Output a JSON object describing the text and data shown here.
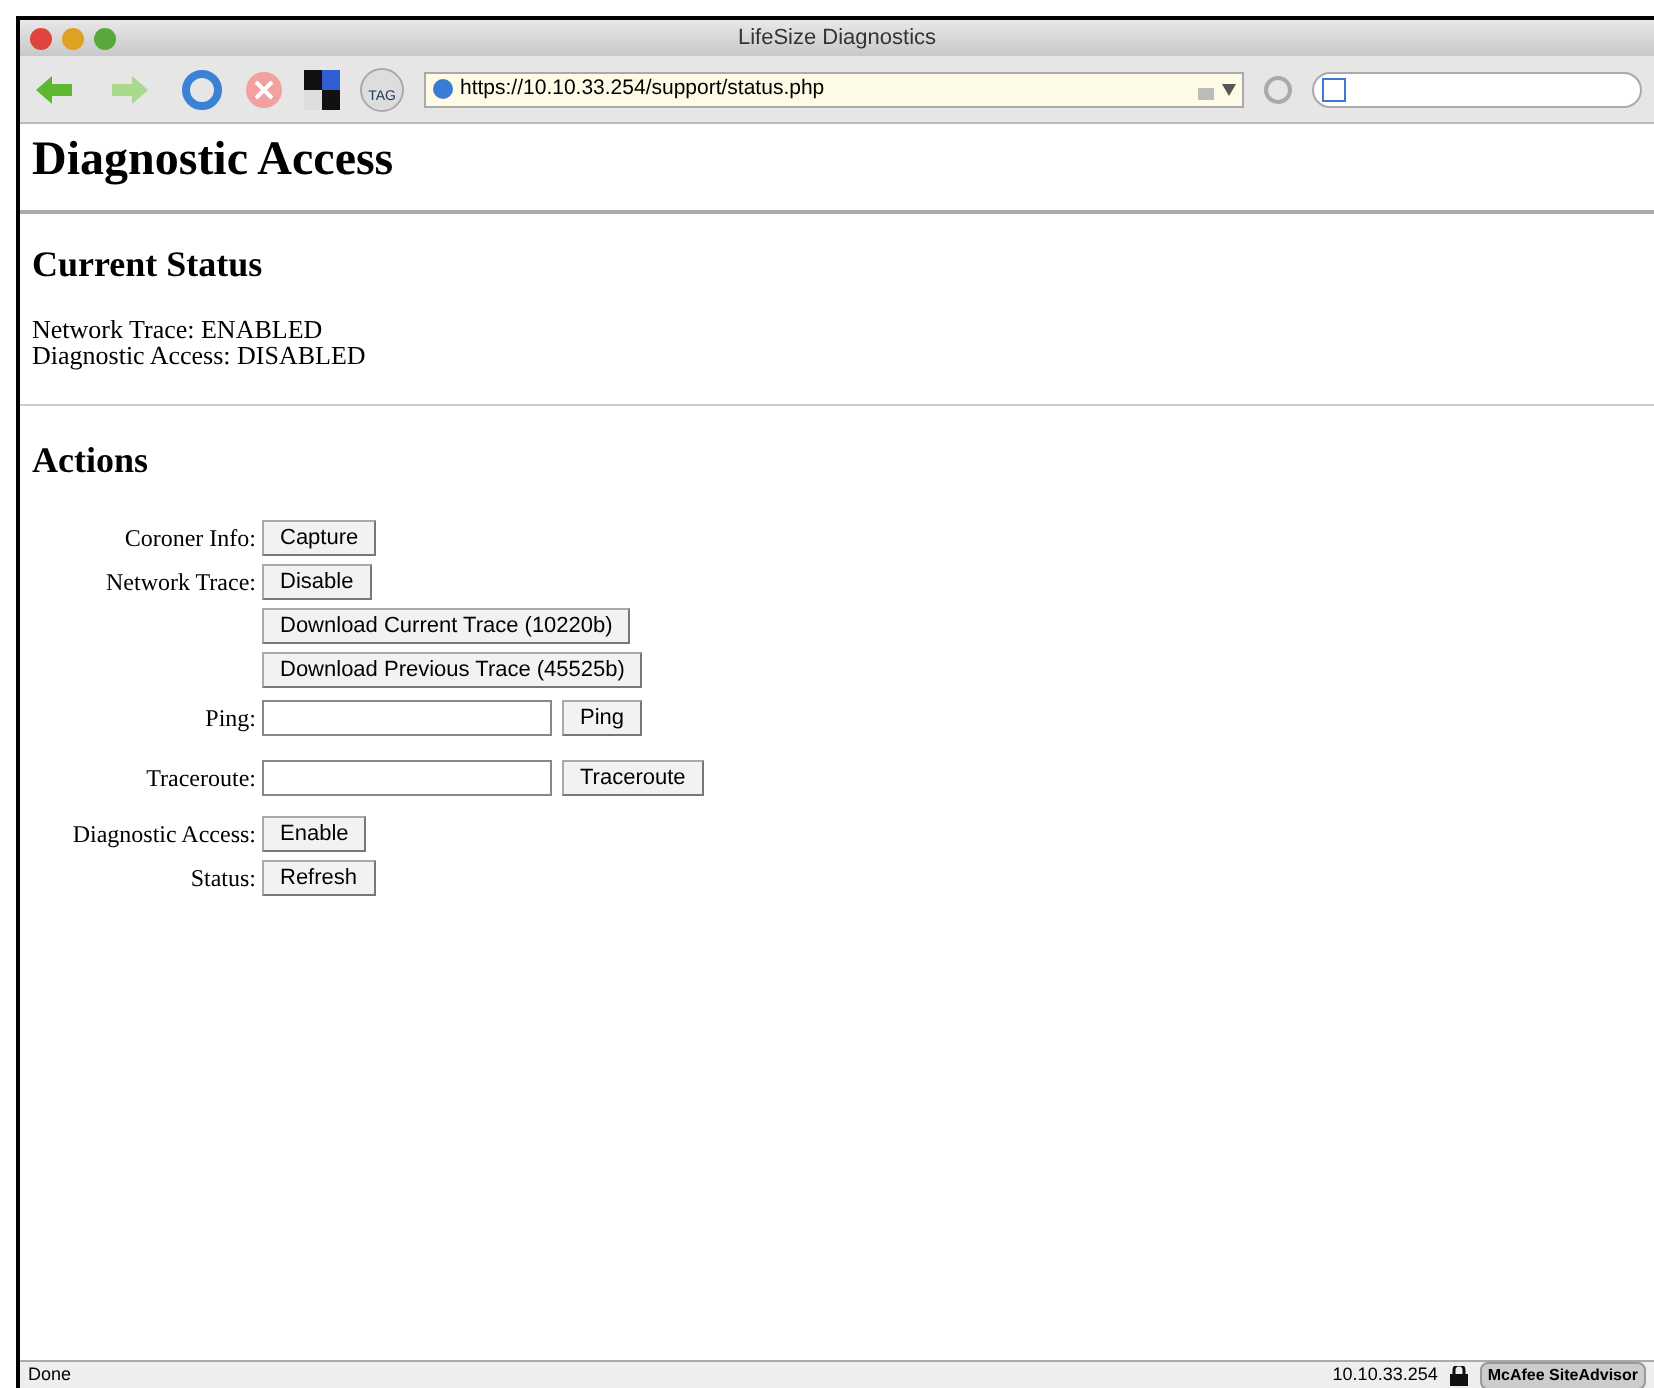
{
  "window": {
    "title": "LifeSize Diagnostics"
  },
  "toolbar": {
    "url": "https://10.10.33.254/support/status.php",
    "tag_label": "TAG"
  },
  "page": {
    "heading": "Diagnostic Access",
    "status_section": {
      "heading": "Current Status",
      "lines": [
        "Network Trace: ENABLED",
        "Diagnostic Access: DISABLED"
      ]
    },
    "actions_section": {
      "heading": "Actions",
      "rows": [
        {
          "kind": "button",
          "label": "Coroner Info:",
          "button": "Capture"
        },
        {
          "kind": "button",
          "label": "Network Trace:",
          "button": "Disable"
        },
        {
          "kind": "button",
          "button": "Download Current Trace (10220b)"
        },
        {
          "kind": "button",
          "button": "Download Previous Trace (45525b)"
        },
        {
          "kind": "field",
          "label": "Ping:",
          "button": "Ping"
        },
        {
          "kind": "field",
          "label": "Traceroute:",
          "button": "Traceroute"
        },
        {
          "kind": "button",
          "label": "Diagnostic Access:",
          "button": "Enable"
        },
        {
          "kind": "button",
          "label": "Status:",
          "button": "Refresh"
        }
      ]
    }
  },
  "status_bar": {
    "text": "Done",
    "host": "10.10.33.254",
    "addon": "McAfee SiteAdvisor"
  }
}
